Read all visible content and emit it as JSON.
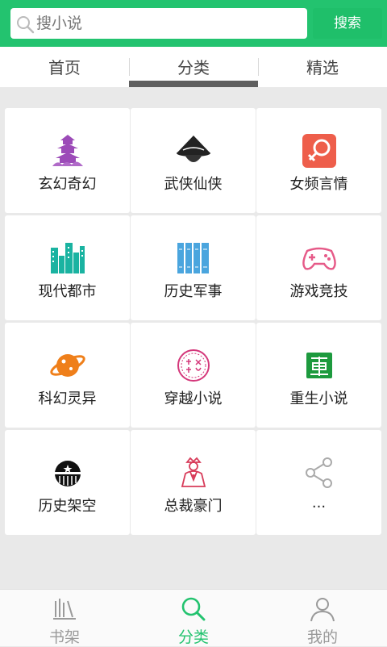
{
  "search": {
    "placeholder": "搜小说",
    "button_label": "搜索"
  },
  "tabs": [
    {
      "label": "首页"
    },
    {
      "label": "分类"
    },
    {
      "label": "精选"
    }
  ],
  "categories": [
    {
      "label": "玄幻奇幻",
      "icon": "fantasy-pagoda-icon"
    },
    {
      "label": "武侠仙侠",
      "icon": "wuxia-hat-icon"
    },
    {
      "label": "女频言情",
      "icon": "female-symbol-icon"
    },
    {
      "label": "现代都市",
      "icon": "city-buildings-icon"
    },
    {
      "label": "历史军事",
      "icon": "books-icon"
    },
    {
      "label": "游戏竞技",
      "icon": "gamepad-icon"
    },
    {
      "label": "科幻灵异",
      "icon": "planet-icon"
    },
    {
      "label": "穿越小说",
      "icon": "time-travel-stamp-icon"
    },
    {
      "label": "重生小说",
      "icon": "rebirth-stamp-icon"
    },
    {
      "label": "历史架空",
      "icon": "history-dome-icon"
    },
    {
      "label": "总裁豪门",
      "icon": "ceo-figure-icon"
    },
    {
      "label": "...",
      "icon": "share-icon"
    }
  ],
  "bottom_nav": [
    {
      "label": "书架",
      "icon": "bookshelf-icon"
    },
    {
      "label": "分类",
      "icon": "search-icon"
    },
    {
      "label": "我的",
      "icon": "user-icon"
    }
  ],
  "colors": {
    "brand_green": "#23c36f",
    "active_tab_indicator": "#5f5f5f",
    "text_gray": "#9a9a9a"
  }
}
